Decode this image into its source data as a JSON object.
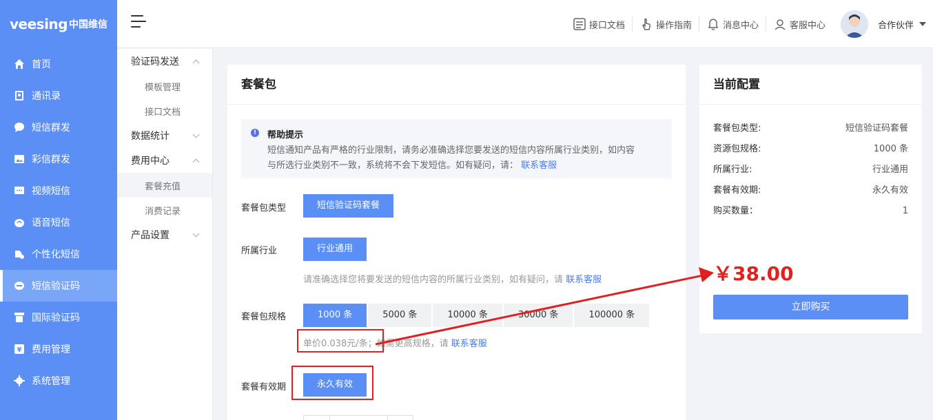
{
  "logo": {
    "en": "veesing",
    "cn": "中国维信"
  },
  "nav": [
    {
      "label": "首页",
      "icon": "home-icon"
    },
    {
      "label": "通讯录",
      "icon": "contacts-icon"
    },
    {
      "label": "短信群发",
      "icon": "sms-icon"
    },
    {
      "label": "彩信群发",
      "icon": "image-icon"
    },
    {
      "label": "视频短信",
      "icon": "video-sms-icon"
    },
    {
      "label": "语音短信",
      "icon": "voice-icon"
    },
    {
      "label": "个性化短信",
      "icon": "personal-icon"
    },
    {
      "label": "短信验证码",
      "icon": "verify-code-icon"
    },
    {
      "label": "国际验证码",
      "icon": "international-icon"
    },
    {
      "label": "费用管理",
      "icon": "yen-icon"
    },
    {
      "label": "系统管理",
      "icon": "gear-icon"
    }
  ],
  "nav_active": "短信验证码",
  "header": {
    "links": [
      {
        "label": "接口文档",
        "icon": "api-doc-icon"
      },
      {
        "label": "操作指南",
        "icon": "hand-pointer-icon"
      },
      {
        "label": "消息中心",
        "icon": "bell-icon"
      },
      {
        "label": "客服中心",
        "icon": "service-icon"
      }
    ],
    "username": "合作伙伴"
  },
  "submenu": {
    "group1": "验证码发送",
    "group1_items": [
      "模板管理",
      "接口文档"
    ],
    "group2": "数据统计",
    "group3": "费用中心",
    "group3_items": [
      "套餐充值",
      "消费记录"
    ],
    "group4": "产品设置"
  },
  "main": {
    "title": "套餐包",
    "help_title": "帮助提示",
    "help_text_1": "短信通知产品有严格的行业限制，请务必准确选择您要发送的短信内容所属行业类别，如内容",
    "help_text_2": "与所选行业类别不一致，系统将不会下发短信。如有疑问，请：",
    "help_link": "联系客服",
    "type_label": "套餐包类型",
    "type_value": "短信验证码套餐",
    "industry_label": "所属行业",
    "industry_value": "行业通用",
    "industry_note": "请准确选择您将要发送的短信内容的所属行业类别，如有疑问，请",
    "industry_note_link": "联系客服",
    "spec_label": "套餐包规格",
    "specs": [
      "1000 条",
      "5000 条",
      "10000 条",
      "30000 条",
      "100000 条"
    ],
    "spec_selected": "1000 条",
    "unit_price": "单价0.038元/条",
    "price_note": "；如需更高规格，请",
    "price_note_link": "联系客服",
    "validity_label": "套餐有效期",
    "validity_value": "永久有效"
  },
  "config": {
    "title": "当前配置",
    "rows": [
      {
        "k": "套餐包类型:",
        "v": "短信验证码套餐"
      },
      {
        "k": "资源包规格:",
        "v": "1000 条"
      },
      {
        "k": "所属行业:",
        "v": "行业通用"
      },
      {
        "k": "套餐有效期:",
        "v": "永久有效"
      },
      {
        "k": "购买数量：",
        "v": "1"
      }
    ],
    "price": "￥38.00",
    "buy_label": "立即购买"
  },
  "colors": {
    "accent": "#5b8ff5",
    "annotation": "#e02020",
    "price": "#e0231e"
  }
}
